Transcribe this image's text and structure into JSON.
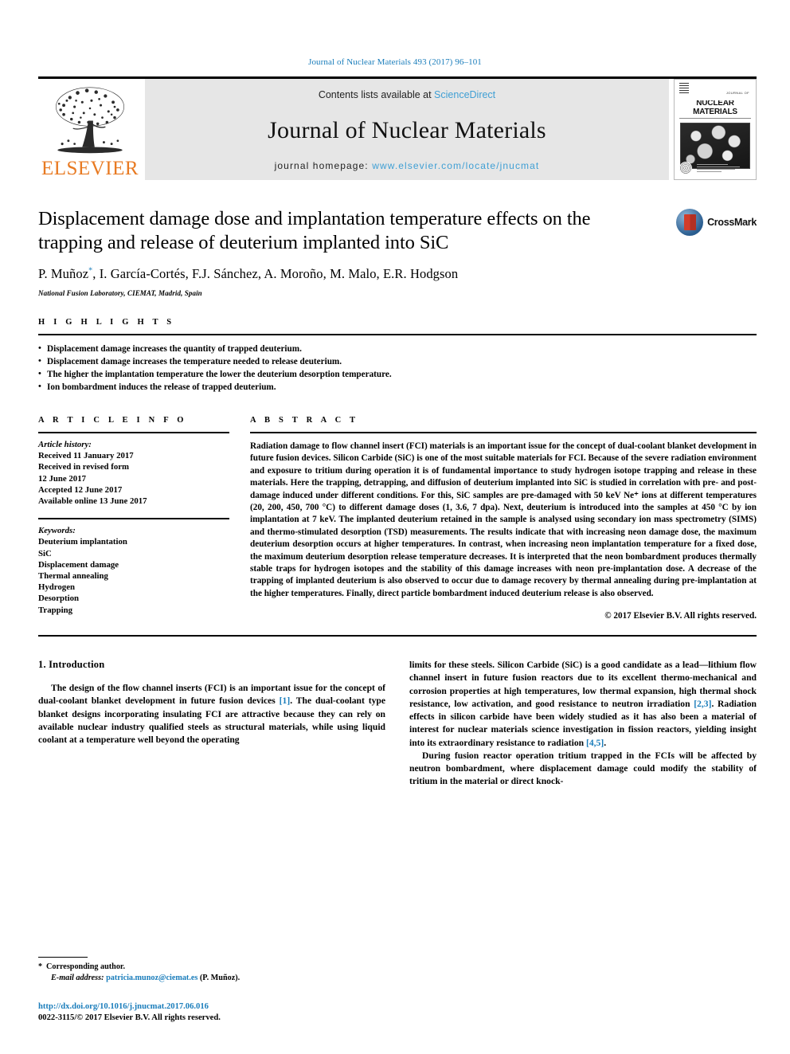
{
  "running_head": "Journal of Nuclear Materials 493 (2017) 96–101",
  "masthead": {
    "publisher_logo_text": "ELSEVIER",
    "contents_prefix": "Contents lists available at ",
    "contents_link": "ScienceDirect",
    "journal_name": "Journal of Nuclear Materials",
    "homepage_prefix": "journal homepage: ",
    "homepage_url": "www.elsevier.com/locate/jnucmat",
    "cover": {
      "line1": "JOURNAL OF",
      "title": "NUCLEAR MATERIALS"
    }
  },
  "article": {
    "title": "Displacement damage dose and implantation temperature effects on the trapping and release of deuterium implanted into SiC",
    "authors": "P. Muñoz, I. García-Cortés, F.J. Sánchez, A. Moroño, M. Malo, E.R. Hodgson",
    "author_marker": "*",
    "affiliation": "National Fusion Laboratory, CIEMAT, Madrid, Spain",
    "crossmark_label": "CrossMark"
  },
  "highlights": {
    "heading": "H I G H L I G H T S",
    "items": [
      "Displacement damage increases the quantity of trapped deuterium.",
      "Displacement damage increases the temperature needed to release deuterium.",
      "The higher the implantation temperature the lower the deuterium desorption temperature.",
      "Ion bombardment induces the release of trapped deuterium."
    ]
  },
  "article_info": {
    "heading": "A R T I C L E  I N F O",
    "history_label": "Article history:",
    "history": [
      "Received 11 January 2017",
      "Received in revised form",
      "12 June 2017",
      "Accepted 12 June 2017",
      "Available online 13 June 2017"
    ],
    "keywords_label": "Keywords:",
    "keywords": [
      "Deuterium implantation",
      "SiC",
      "Displacement damage",
      "Thermal annealing",
      "Hydrogen",
      "Desorption",
      "Trapping"
    ]
  },
  "abstract": {
    "heading": "A B S T R A C T",
    "text": "Radiation damage to flow channel insert (FCI) materials is an important issue for the concept of dual-coolant blanket development in future fusion devices. Silicon Carbide (SiC) is one of the most suitable materials for FCI. Because of the severe radiation environment and exposure to tritium during operation it is of fundamental importance to study hydrogen isotope trapping and release in these materials. Here the trapping, detrapping, and diffusion of deuterium implanted into SiC is studied in correlation with pre- and post-damage induced under different conditions. For this, SiC samples are pre-damaged with 50 keV Ne⁺ ions at different temperatures (20, 200, 450, 700 °C) to different damage doses (1, 3.6, 7 dpa). Next, deuterium is introduced into the samples at 450 °C by ion implantation at 7 keV. The implanted deuterium retained in the sample is analysed using secondary ion mass spectrometry (SIMS) and thermo-stimulated desorption (TSD) measurements. The results indicate that with increasing neon damage dose, the maximum deuterium desorption occurs at higher temperatures. In contrast, when increasing neon implantation temperature for a fixed dose, the maximum deuterium desorption release temperature decreases. It is interpreted that the neon bombardment produces thermally stable traps for hydrogen isotopes and the stability of this damage increases with neon pre-implantation dose. A decrease of the trapping of implanted deuterium is also observed to occur due to damage recovery by thermal annealing during pre-implantation at the higher temperatures. Finally, direct particle bombardment induced deuterium release is also observed.",
    "copyright": "© 2017 Elsevier B.V. All rights reserved."
  },
  "introduction": {
    "heading": "1. Introduction",
    "left_para_1_a": "The design of the flow channel inserts (FCI) is an important issue for the concept of dual-coolant blanket development in future fusion devices ",
    "left_ref_1": "[1]",
    "left_para_1_b": ". The dual-coolant type blanket designs incorporating insulating FCI are attractive because they can rely on available nuclear industry qualified steels as structural materials, while using liquid coolant at a temperature well beyond the operating",
    "right_para_1_a": "limits for these steels. Silicon Carbide (SiC) is a good candidate as a lead—lithium flow channel insert in future fusion reactors due to its excellent thermo-mechanical and corrosion properties at high temperatures, low thermal expansion, high thermal shock resistance, low activation, and good resistance to neutron irradiation ",
    "right_ref_1": "[2,3]",
    "right_para_1_b": ". Radiation effects in silicon carbide have been widely studied as it has also been a material of interest for nuclear materials science investigation in fission reactors, yielding insight into its extraordinary resistance to radiation ",
    "right_ref_2": "[4,5]",
    "right_para_1_c": ".",
    "right_para_2": "During fusion reactor operation tritium trapped in the FCIs will be affected by neutron bombardment, where displacement damage could modify the stability of tritium in the material or direct knock-"
  },
  "footer": {
    "corresponding_star": "*",
    "corresponding_label": "Corresponding author.",
    "email_label": "E-mail address:",
    "email": "patricia.munoz@ciemat.es",
    "email_suffix": "(P. Muñoz).",
    "doi": "http://dx.doi.org/10.1016/j.jnucmat.2017.06.016",
    "issn_line": "0022-3115/© 2017 Elsevier B.V. All rights reserved."
  }
}
